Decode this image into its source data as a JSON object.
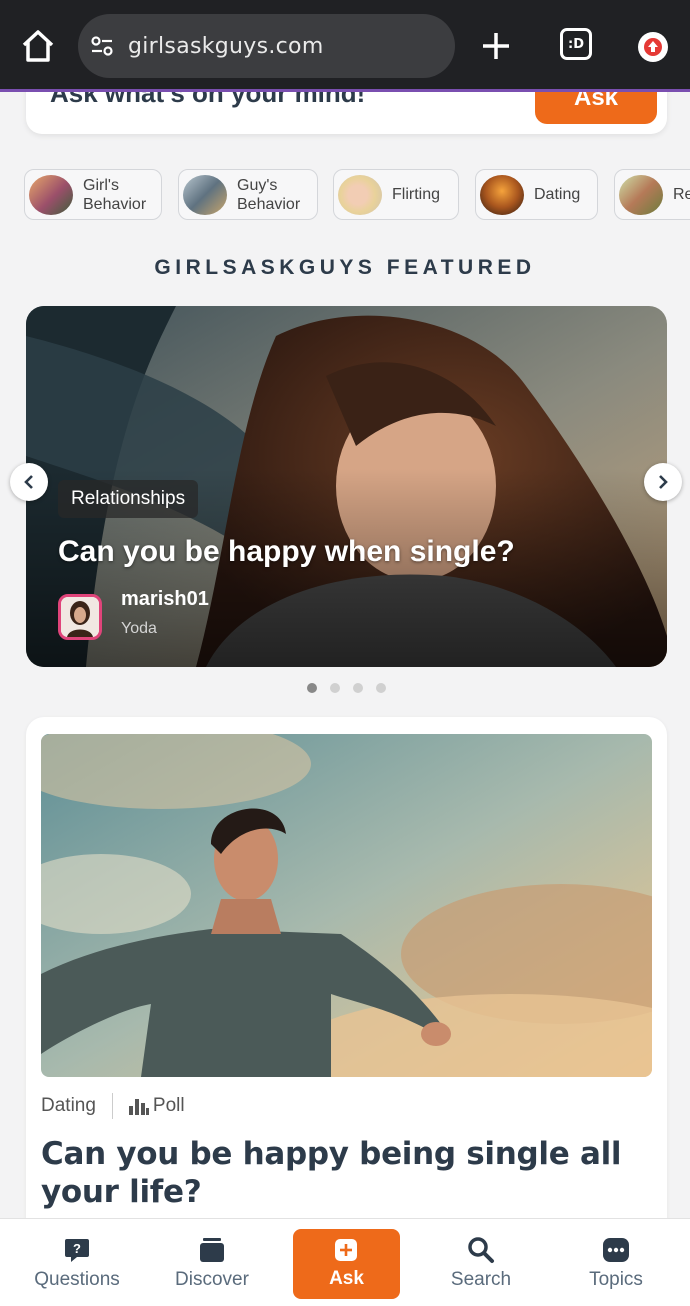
{
  "browser": {
    "url": "girlsaskguys.com",
    "tabs_count": ":D",
    "icons": [
      "home-icon",
      "site-settings-icon",
      "new-tab-icon",
      "tab-switcher-icon",
      "update-icon"
    ]
  },
  "ask_box": {
    "prompt": "Ask what's on your mind!",
    "button_label": "Ask"
  },
  "topics": [
    {
      "label": "Girl's Behavior"
    },
    {
      "label": "Guy's Behavior"
    },
    {
      "label": "Flirting"
    },
    {
      "label": "Dating"
    },
    {
      "label": "Relationships"
    }
  ],
  "featured": {
    "heading": "GIRLSASKGUYS FEATURED",
    "slides_total": 4,
    "active_slide": 1,
    "slide": {
      "category": "Relationships",
      "title": "Can you be happy when single?",
      "author": "marish01",
      "author_rank": "Yoda"
    }
  },
  "question_card": {
    "category": "Dating",
    "type_label": "Poll",
    "title": "Can you be happy being single all your life?"
  },
  "bottom_nav": {
    "questions": "Questions",
    "discover": "Discover",
    "ask": "Ask",
    "search": "Search",
    "topics": "Topics"
  },
  "colors": {
    "accent": "#ee6a1a",
    "heading": "#2d3b4a",
    "browser_bar": "#202124",
    "nav_text": "#5a6b7c"
  }
}
